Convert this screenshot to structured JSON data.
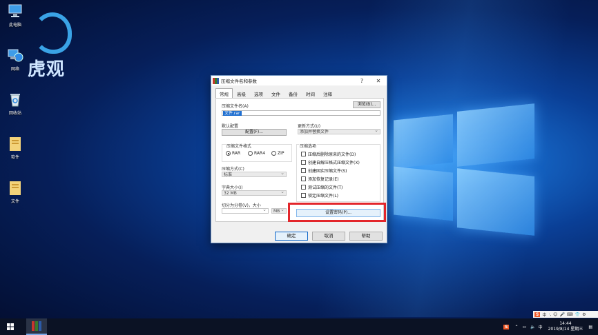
{
  "desktop": {
    "icons": [
      {
        "label": "此电脑",
        "icon": "computer-icon"
      },
      {
        "label": "网络",
        "icon": "network-icon"
      },
      {
        "label": "回收站",
        "icon": "recycle-bin-icon"
      },
      {
        "label": "软件",
        "icon": "folder-icon"
      },
      {
        "label": "文件",
        "icon": "folder-icon"
      }
    ],
    "brand_text": "虎观"
  },
  "dialog": {
    "title": "压缩文件名和参数",
    "help_label": "?",
    "close_label": "✕",
    "tabs": [
      "常规",
      "高级",
      "选项",
      "文件",
      "备份",
      "时间",
      "注释"
    ],
    "archive_name_label": "压缩文件名(A)",
    "archive_name_value": "文件.rar",
    "browse_button": "浏览(B)...",
    "profiles_label": "默认配置",
    "profiles_button": "配置(F)...",
    "update_mode_label": "更新方式(U)",
    "update_mode_value": "添加并替换文件",
    "format_group_label": "压缩文件格式",
    "format_options": [
      {
        "label": "RAR",
        "selected": true
      },
      {
        "label": "RAR4",
        "selected": false
      },
      {
        "label": "ZIP",
        "selected": false
      }
    ],
    "method_label": "压缩方式(C)",
    "method_value": "标准",
    "dict_label": "字典大小(I)",
    "dict_value": "32 MB",
    "split_label": "切分为分卷(V)，大小",
    "split_unit": "MB",
    "options_group_label": "压缩选项",
    "options": [
      "压缩后删除原来的文件(D)",
      "创建自解压格式压缩文件(X)",
      "创建固实压缩文件(S)",
      "添加恢复记录(E)",
      "测试压缩的文件(T)",
      "锁定压缩文件(L)"
    ],
    "set_password_button": "设置密码(P)...",
    "ok_button": "确定",
    "cancel_button": "取消",
    "help_button": "帮助"
  },
  "taskbar": {
    "ime_items": [
      "S",
      "中",
      "·,",
      "☺",
      "🎤",
      "⌨",
      "👕",
      "⚙"
    ],
    "time": "14:44",
    "date": "2019/8/14 星期三",
    "accent_color": "#e3262b"
  }
}
